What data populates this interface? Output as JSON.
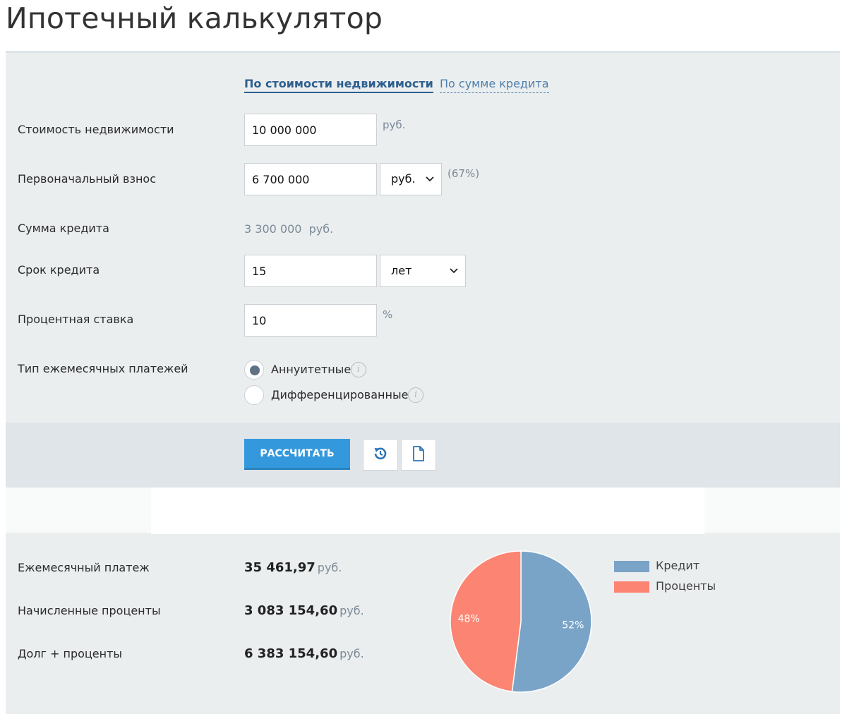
{
  "title": "Ипотечный калькулятор",
  "tabs": [
    {
      "label": "По стоимости недвижимости",
      "active": true
    },
    {
      "label": "По сумме кредита",
      "active": false
    }
  ],
  "form": {
    "property_cost": {
      "label": "Стоимость недвижимости",
      "value": "10 000 000",
      "unit": "руб."
    },
    "down_payment": {
      "label": "Первоначальный взнос",
      "value": "6 700 000",
      "unit_select": "руб.",
      "percent": "(67%)"
    },
    "loan_amount": {
      "label": "Сумма кредита",
      "value": "3 300 000",
      "unit": "руб."
    },
    "term": {
      "label": "Срок кредита",
      "value": "15",
      "unit_select": "лет"
    },
    "rate": {
      "label": "Процентная ставка",
      "value": "10",
      "unit": "%"
    },
    "payment_type": {
      "label": "Тип ежемесячных платежей",
      "options": [
        {
          "label": "Аннуитетные",
          "selected": true
        },
        {
          "label": "Дифференцированные",
          "selected": false
        }
      ]
    }
  },
  "actions": {
    "calculate_label": "РАССЧИТАТЬ",
    "reset_icon": "reset-icon",
    "document_icon": "document-icon"
  },
  "results": {
    "monthly": {
      "label": "Ежемесячный платеж",
      "value": "35 461,97",
      "unit": "руб."
    },
    "interest": {
      "label": "Начисленные проценты",
      "value": "3 083 154,60",
      "unit": "руб."
    },
    "total": {
      "label": "Долг + проценты",
      "value": "6 383 154,60",
      "unit": "руб."
    }
  },
  "chart_data": {
    "type": "pie",
    "slices": [
      {
        "name": "Кредит",
        "value": 52,
        "label": "52%",
        "color": "#79a4c8"
      },
      {
        "name": "Проценты",
        "value": 48,
        "label": "48%",
        "color": "#fb8572"
      }
    ]
  },
  "colors": {
    "accent": "#3499dc",
    "tab_active": "#2e5f8f",
    "panel_bg": "#ebeeef"
  }
}
